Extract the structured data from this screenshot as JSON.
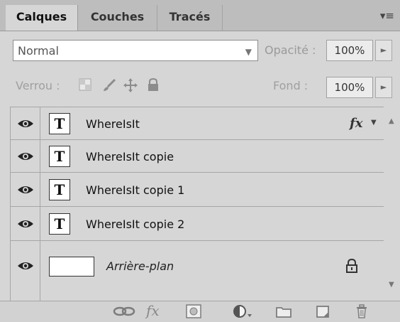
{
  "tabs": [
    {
      "label": "Calques",
      "active": true
    },
    {
      "label": "Couches",
      "active": false
    },
    {
      "label": "Tracés",
      "active": false
    }
  ],
  "panel_menu_icon": "panel-menu-icon",
  "blend": {
    "mode": "Normal"
  },
  "opacity": {
    "label": "Opacité :",
    "value": "100%"
  },
  "lock": {
    "label": "Verrou :",
    "icons": [
      "lock-transparent-icon",
      "lock-image-icon",
      "lock-position-icon",
      "lock-all-icon"
    ]
  },
  "fill": {
    "label": "Fond :",
    "value": "100%"
  },
  "layers": [
    {
      "name": "WhereIsIt",
      "type": "text",
      "visible": true,
      "has_fx": true,
      "fx_label": "fx"
    },
    {
      "name": "WhereIsIt copie",
      "type": "text",
      "visible": true
    },
    {
      "name": "WhereIsIt copie 1",
      "type": "text",
      "visible": true
    },
    {
      "name": "WhereIsIt copie 2",
      "type": "text",
      "visible": true
    },
    {
      "name": "Arrière-plan",
      "type": "background",
      "visible": true,
      "locked": true
    }
  ],
  "text_thumb_glyph": "T",
  "bottom_toolbar": [
    "link-layers-icon",
    "fx-icon",
    "add-mask-icon",
    "adjustment-layer-icon",
    "new-group-icon",
    "new-layer-icon",
    "delete-icon"
  ],
  "toolbar_fx_label": "fx"
}
